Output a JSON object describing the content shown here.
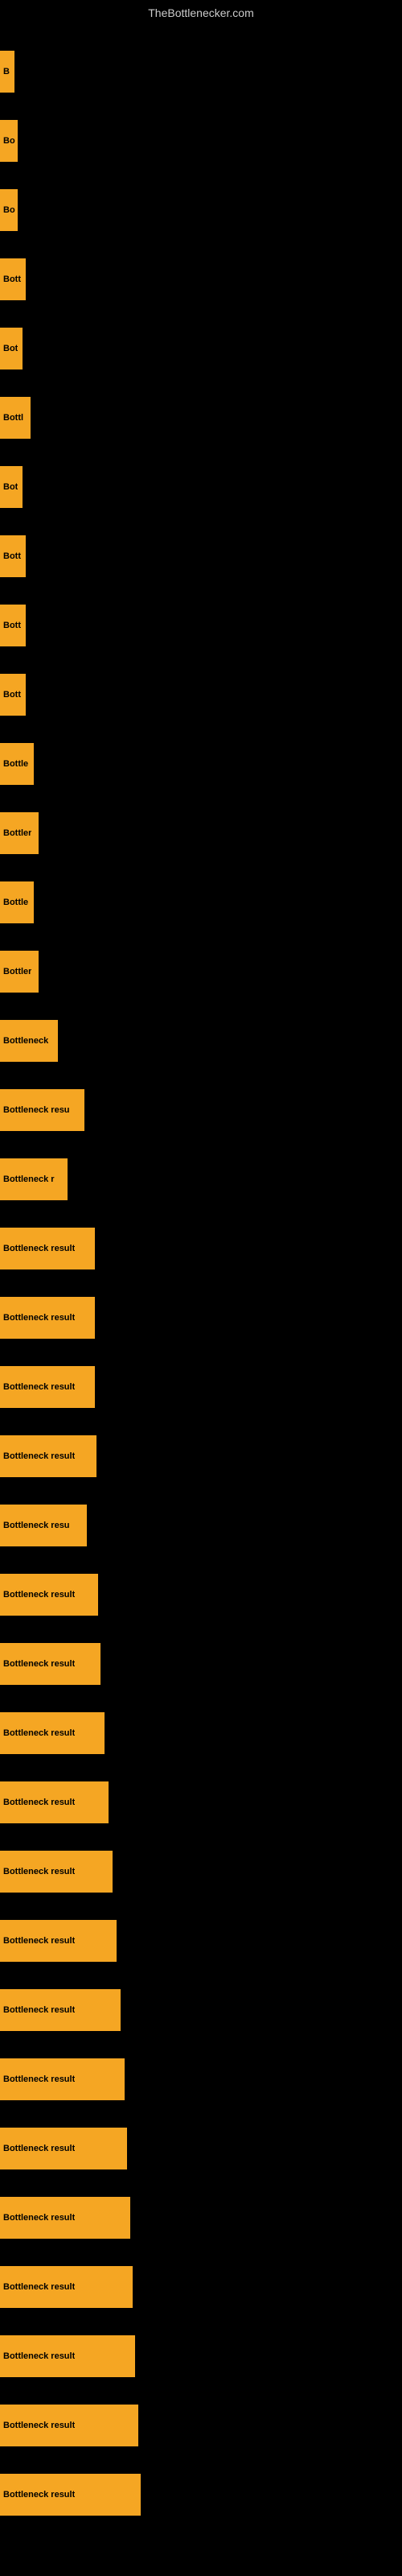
{
  "site": {
    "title": "TheBottlenecker.com"
  },
  "bars": [
    {
      "label": "B",
      "width": 18
    },
    {
      "label": "Bo",
      "width": 22
    },
    {
      "label": "Bo",
      "width": 22
    },
    {
      "label": "Bott",
      "width": 32
    },
    {
      "label": "Bot",
      "width": 28
    },
    {
      "label": "Bottl",
      "width": 38
    },
    {
      "label": "Bot",
      "width": 28
    },
    {
      "label": "Bott",
      "width": 32
    },
    {
      "label": "Bott",
      "width": 32
    },
    {
      "label": "Bott",
      "width": 32
    },
    {
      "label": "Bottle",
      "width": 42
    },
    {
      "label": "Bottler",
      "width": 48
    },
    {
      "label": "Bottle",
      "width": 42
    },
    {
      "label": "Bottler",
      "width": 48
    },
    {
      "label": "Bottleneck",
      "width": 72
    },
    {
      "label": "Bottleneck resu",
      "width": 105
    },
    {
      "label": "Bottleneck r",
      "width": 84
    },
    {
      "label": "Bottleneck result",
      "width": 118
    },
    {
      "label": "Bottleneck result",
      "width": 118
    },
    {
      "label": "Bottleneck result",
      "width": 118
    },
    {
      "label": "Bottleneck result",
      "width": 120
    },
    {
      "label": "Bottleneck resu",
      "width": 108
    },
    {
      "label": "Bottleneck result",
      "width": 122
    },
    {
      "label": "Bottleneck result",
      "width": 125
    },
    {
      "label": "Bottleneck result",
      "width": 130
    },
    {
      "label": "Bottleneck result",
      "width": 135
    },
    {
      "label": "Bottleneck result",
      "width": 140
    },
    {
      "label": "Bottleneck result",
      "width": 145
    },
    {
      "label": "Bottleneck result",
      "width": 150
    },
    {
      "label": "Bottleneck result",
      "width": 155
    },
    {
      "label": "Bottleneck result",
      "width": 158
    },
    {
      "label": "Bottleneck result",
      "width": 162
    },
    {
      "label": "Bottleneck result",
      "width": 165
    },
    {
      "label": "Bottleneck result",
      "width": 168
    },
    {
      "label": "Bottleneck result",
      "width": 172
    },
    {
      "label": "Bottleneck result",
      "width": 175
    }
  ]
}
